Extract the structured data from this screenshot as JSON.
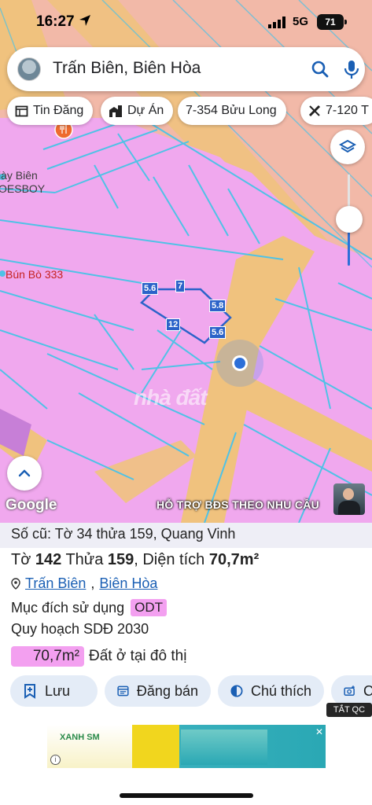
{
  "status_bar": {
    "time": "16:27",
    "network": "5G",
    "battery": "71"
  },
  "search": {
    "query": "Trấn Biên, Biên Hòa"
  },
  "chips": [
    {
      "label": "Tin Đăng",
      "icon": "listing-icon"
    },
    {
      "label": "Dự Án",
      "icon": "building-icon"
    },
    {
      "label": "7-354 Bửu Long",
      "icon": ""
    },
    {
      "label": "7-120 T",
      "icon": "ruler-icon"
    }
  ],
  "map": {
    "pois": {
      "giay_bien": "iày Biên",
      "oesboy": "OESBOY",
      "bun_bo": "Bún Bò 333"
    },
    "dimensions": {
      "top": "7",
      "left": "5.6",
      "right_upper": "5.8",
      "right_lower": "5.6",
      "bottom": "12"
    },
    "watermark": "nhà đất",
    "google": "Google",
    "banner": "HỖ TRỢ BĐS  THEO NHU CẦU",
    "colors": {
      "land": "#f0a8ee",
      "road": "#f0c27e",
      "boundary": "#4fc2e6",
      "highlight": "#2b63c9"
    }
  },
  "parcel": {
    "old_number": "Số cũ: Tờ 34 thửa 159, Quang Vinh",
    "sheet_label": "Tờ ",
    "sheet_no": "142",
    "plot_label": " Thửa ",
    "plot_no": "159",
    "area_label": ", Diện tích ",
    "area": "70,7m²",
    "ward": "Trấn Biên",
    "city": "Biên Hòa",
    "purpose_label": "Mục đích sử dụng",
    "purpose_code": "ODT",
    "plan_label": "Quy hoạch SDĐ 2030",
    "plan_area": "70,7m²",
    "plan_use": "Đất ở tại đô thị"
  },
  "actions": {
    "save": "Lưu",
    "post": "Đăng bán",
    "legend": "Chú thích",
    "more": "C"
  },
  "ad": {
    "tag": "TẮT QC",
    "brand": "XANH SM"
  }
}
